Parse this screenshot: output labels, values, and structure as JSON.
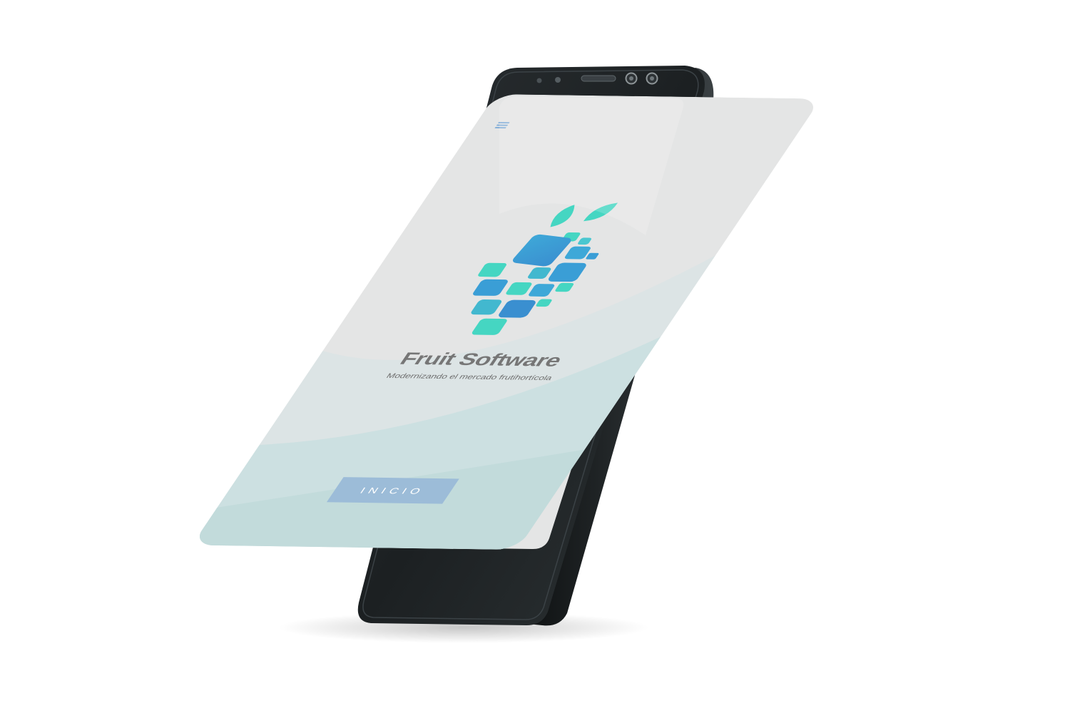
{
  "app": {
    "menu_icon": "hamburger-menu-icon",
    "logo_icon": "pixel-fruit-logo-icon",
    "title": "Fruit Software",
    "tagline": "Modernizando el mercado frutihortícola",
    "start_button_label": "INICIO"
  },
  "colors": {
    "screen_background": "#e4e5e5",
    "wave_tint": "#c9dfe0",
    "accent_blue": "#3a9ed6",
    "accent_teal": "#45d6c2",
    "button": "#9cbcd8",
    "title_text": "#767676",
    "phone_body": "#1d2123"
  }
}
